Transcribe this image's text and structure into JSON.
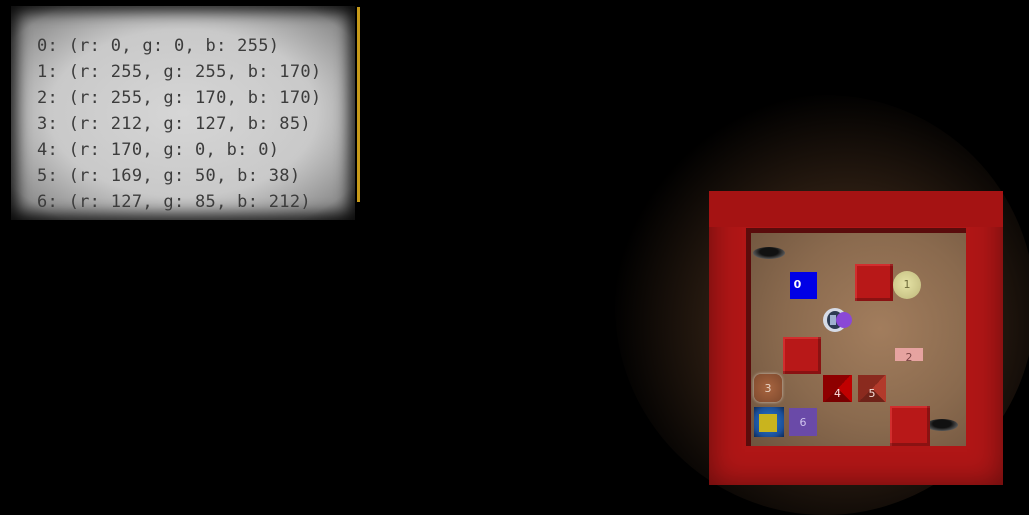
{
  "legend": {
    "entries": [
      "0: (r: 0, g: 0, b: 255)",
      "1: (r: 255, g: 255, b: 170)",
      "2: (r: 255, g: 170, b: 170)",
      "3: (r: 212, g: 127, b: 85)",
      "4: (r: 170, g: 0, b: 0)",
      "5: (r: 169, g: 50, b: 38)",
      "6: (r: 127, g: 85, b: 212)"
    ]
  },
  "room": {
    "wall_color": "#b01616",
    "floor_color": "#9a7657",
    "objects": [
      {
        "id": "0",
        "shape": "square",
        "color": "#0000ff"
      },
      {
        "id": "1",
        "shape": "circle",
        "color": "#ffffaa"
      },
      {
        "id": "2",
        "shape": "flat-rectangle",
        "color": "#ffaaaa"
      },
      {
        "id": "3",
        "shape": "rounded-square",
        "color": "#d47f55"
      },
      {
        "id": "4",
        "shape": "pyramid",
        "color": "#aa0000"
      },
      {
        "id": "5",
        "shape": "pyramid",
        "color": "#a93226"
      },
      {
        "id": "6",
        "shape": "square",
        "color": "#7f55d4"
      }
    ]
  }
}
